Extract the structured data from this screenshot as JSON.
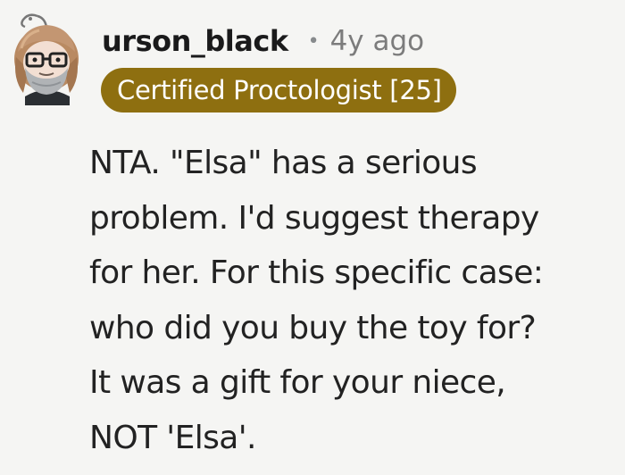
{
  "comment": {
    "author": "urson_black",
    "separator": "•",
    "age": "4y ago",
    "flair": "Certified Proctologist [25]",
    "flair_color": "#8e6f10",
    "body_lines": [
      "NTA. \"Elsa\" has a serious",
      "problem. I'd suggest therapy",
      "for her. For this specific case:",
      "who did you buy the toy for?",
      "It was a gift for your niece,",
      "NOT 'Elsa'."
    ]
  },
  "avatar": {
    "icon": "snoo-avatar-icon"
  }
}
